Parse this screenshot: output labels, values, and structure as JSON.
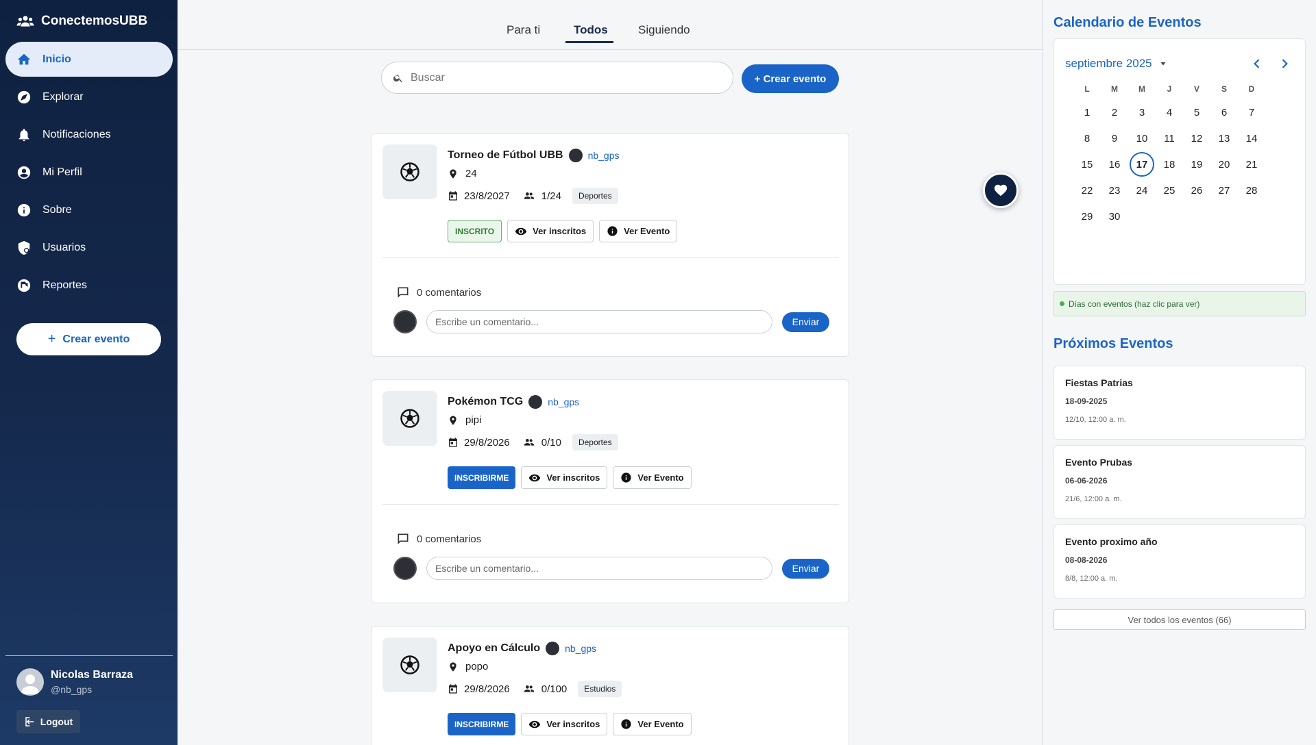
{
  "app": {
    "brand": "ConectemosUBB"
  },
  "sidebar": {
    "items": [
      {
        "label": "Inicio",
        "icon": "home-icon",
        "active": true
      },
      {
        "label": "Explorar",
        "icon": "compass-icon"
      },
      {
        "label": "Notificaciones",
        "icon": "bell-icon"
      },
      {
        "label": "Mi Perfil",
        "icon": "account-circle-icon"
      },
      {
        "label": "Sobre",
        "icon": "info-icon"
      },
      {
        "label": "Usuarios",
        "icon": "admin-shield-icon"
      },
      {
        "label": "Reportes",
        "icon": "flag-icon"
      }
    ],
    "create_label": "Crear evento",
    "user": {
      "name": "Nicolas Barraza",
      "handle": "@nb_gps"
    },
    "logout_label": "Logout"
  },
  "tabs": [
    "Para ti",
    "Todos",
    "Siguiendo"
  ],
  "active_tab": "Todos",
  "search": {
    "placeholder": "Buscar"
  },
  "create_main_label": "+ Crear evento",
  "cards": [
    {
      "title": "Torneo de Fútbol UBB",
      "author": "nb_gps",
      "location": "24",
      "date": "23/8/2027",
      "capacity": "1/24",
      "tag": "Deportes",
      "status": "INSCRITO",
      "status_kind": "enrolled",
      "view_enrolled": "Ver inscritos",
      "view_event": "Ver Evento",
      "comments": "0 comentarios",
      "comment_placeholder": "Escribe un comentario...",
      "send": "Enviar"
    },
    {
      "title": "Pokémon TCG",
      "author": "nb_gps",
      "location": "pipi",
      "date": "29/8/2026",
      "capacity": "0/10",
      "tag": "Deportes",
      "status": "INSCRIBIRME",
      "status_kind": "join",
      "view_enrolled": "Ver inscritos",
      "view_event": "Ver Evento",
      "comments": "0 comentarios",
      "comment_placeholder": "Escribe un comentario...",
      "send": "Enviar"
    },
    {
      "title": "Apoyo en Cálculo",
      "author": "nb_gps",
      "location": "popo",
      "date": "29/8/2026",
      "capacity": "0/100",
      "tag": "Estudios",
      "status": "INSCRIBIRME",
      "status_kind": "join",
      "view_enrolled": "Ver inscritos",
      "view_event": "Ver Evento"
    }
  ],
  "calendar": {
    "title": "Calendario de Eventos",
    "month": "septiembre 2025",
    "weekdays": [
      "L",
      "M",
      "M",
      "J",
      "V",
      "S",
      "D"
    ],
    "first_weekday_offset": 0,
    "days_in_month": 30,
    "today": 17,
    "legend": "Días con eventos (haz clic para ver)"
  },
  "upcoming": {
    "title": "Próximos Eventos",
    "events": [
      {
        "name": "Fiestas Patrias",
        "date": "18-09-2025",
        "time": "12/10, 12:00 a. m."
      },
      {
        "name": "Evento Prubas",
        "date": "06-06-2026",
        "time": "21/6, 12:00 a. m."
      },
      {
        "name": "Evento proximo año",
        "date": "08-08-2026",
        "time": "8/8, 12:00 a. m."
      }
    ],
    "all_label": "Ver todos los eventos (66)"
  },
  "colors": {
    "accent": "#1a64c8",
    "sidebar": "#0f2140",
    "success": "#2e7d32"
  }
}
